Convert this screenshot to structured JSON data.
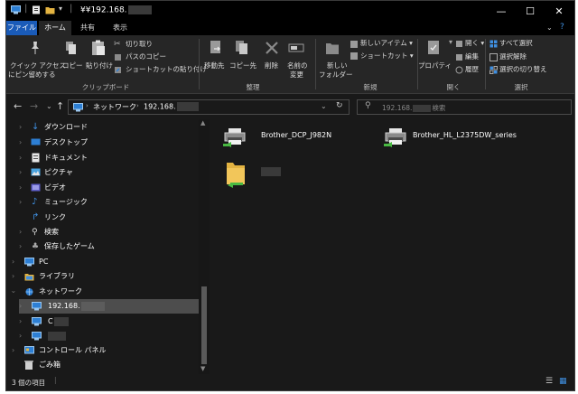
{
  "window": {
    "title": "¥¥192.168.",
    "controls": {
      "minimize": "—",
      "maximize": "☐",
      "close": "✕"
    }
  },
  "tabs": [
    {
      "label": "ファイル"
    },
    {
      "label": "ホーム"
    },
    {
      "label": "共有"
    },
    {
      "label": "表示"
    }
  ],
  "ribbon": {
    "clipboard": {
      "pin_label_1": "クイック アクセス",
      "pin_label_2": "にピン留めする",
      "copy": "コピー",
      "paste": "貼り付け",
      "cut": "切り取り",
      "copy_path": "パスのコピー",
      "paste_shortcut": "ショートカットの貼り付け",
      "group": "クリップボード"
    },
    "organize": {
      "move_to": "移動先",
      "copy_to": "コピー先",
      "delete": "削除",
      "rename_1": "名前の",
      "rename_2": "変更",
      "group": "整理"
    },
    "new": {
      "new_folder_1": "新しい",
      "new_folder_2": "フォルダー",
      "new_item": "新しいアイテム",
      "shortcut": "ショートカット",
      "group": "新規"
    },
    "open": {
      "properties": "プロパティ",
      "open": "開く",
      "edit": "編集",
      "history": "履歴",
      "group": "開く"
    },
    "select": {
      "select_all": "すべて選択",
      "select_none": "選択解除",
      "invert": "選択の切り替え",
      "group": "選択"
    }
  },
  "address": {
    "breadcrumb_network": "ネットワーク",
    "breadcrumb_host": "192.168.",
    "search_placeholder": "192.168.",
    "search_suffix": "検索"
  },
  "nav": {
    "items": [
      {
        "label": "ダウンロード"
      },
      {
        "label": "デスクトップ"
      },
      {
        "label": "ドキュメント"
      },
      {
        "label": "ピクチャ"
      },
      {
        "label": "ビデオ"
      },
      {
        "label": "ミュージック"
      },
      {
        "label": "リンク"
      },
      {
        "label": "検索"
      },
      {
        "label": "保存したゲーム"
      },
      {
        "label": "PC"
      },
      {
        "label": "ライブラリ"
      },
      {
        "label": "ネットワーク"
      },
      {
        "label": "192.168."
      },
      {
        "label": "C"
      },
      {
        "label": ""
      },
      {
        "label": "コントロール パネル"
      },
      {
        "label": "ごみ箱"
      }
    ]
  },
  "content": {
    "items": [
      {
        "label": "Brother_DCP_J982N",
        "icon": "printer-icon"
      },
      {
        "label": "Brother_HL_L2375DW_series",
        "icon": "printer-icon"
      },
      {
        "label": "",
        "icon": "shared-folder-icon"
      }
    ]
  },
  "status": {
    "count": "3 個の項目"
  },
  "colors": {
    "file_tab": "#1a5bb8",
    "background": "#191919",
    "ribbon": "#262626",
    "selected": "#4d4d4d"
  }
}
